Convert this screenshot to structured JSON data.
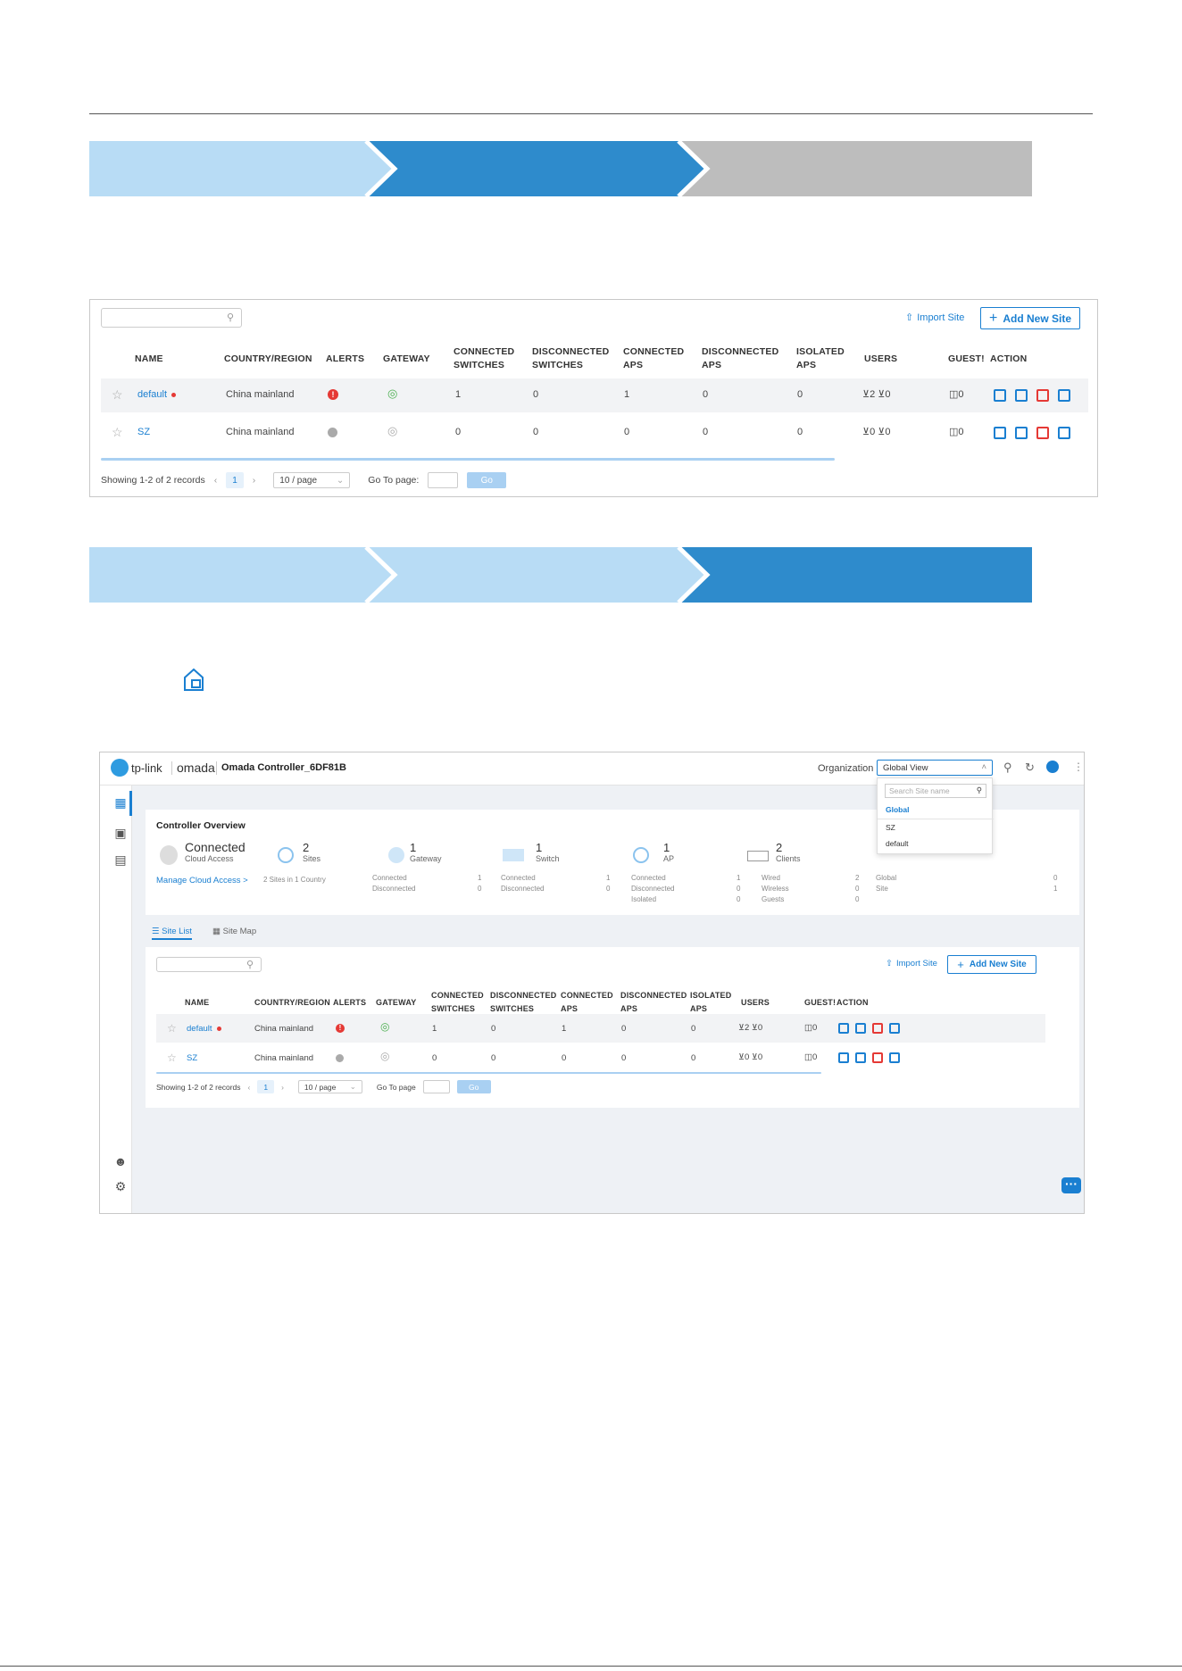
{
  "steps_top": {
    "colors": [
      "#b8dcf5",
      "#2e8bcc",
      "#bdbdbd"
    ]
  },
  "steps_mid": {
    "colors": [
      "#b8dcf5",
      "#b8dcf5",
      "#2e8bcc"
    ]
  },
  "colors": {
    "accent": "#1a7fd1",
    "alert_red": "#e53935",
    "gateway_green": "#4caf50"
  },
  "table": {
    "import_label": "Import Site",
    "add_label": "Add New Site",
    "headers": {
      "name": "NAME",
      "country": "COUNTRY/REGION",
      "alerts": "ALERTS",
      "gateway": "GATEWAY",
      "conn_sw_1": "CONNECTED",
      "conn_sw_2": "SWITCHES",
      "disc_sw_1": "DISCONNECTED",
      "disc_sw_2": "SWITCHES",
      "conn_ap_1": "CONNECTED",
      "conn_ap_2": "APS",
      "disc_ap_1": "DISCONNECTED",
      "disc_ap_2": "APS",
      "iso_1": "ISOLATED",
      "iso_2": "APS",
      "users": "USERS",
      "guests": "GUEST!",
      "action": "ACTION"
    },
    "rows": [
      {
        "name": "default",
        "country": "China mainland",
        "conn_sw": "1",
        "disc_sw": "0",
        "conn_ap": "1",
        "disc_ap": "0",
        "iso": "0",
        "users_a": "2",
        "users_b": "0",
        "guests": "0"
      },
      {
        "name": "SZ",
        "country": "China mainland",
        "conn_sw": "0",
        "disc_sw": "0",
        "conn_ap": "0",
        "disc_ap": "0",
        "iso": "0",
        "users_a": "0",
        "users_b": "0",
        "guests": "0"
      }
    ],
    "showing": "Showing 1-2 of 2 records",
    "page": "1",
    "per_page": "10 / page",
    "goto_label": "Go To page:",
    "go_label": "Go"
  },
  "app": {
    "brand": "tp-link",
    "product": "omada",
    "title": "Omada Controller_6DF81B",
    "org_label": "Organization",
    "org_value": "Global View",
    "dropdown": {
      "search_placeholder": "Search Site name",
      "items": [
        "Global",
        "SZ",
        "default"
      ]
    },
    "overview_title": "Controller Overview",
    "cloud_status": "Connected",
    "cloud_sub": "Cloud Access",
    "manage_link": "Manage Cloud Access >",
    "stats": [
      {
        "num": "2",
        "label": "Sites",
        "sub": "2 Sites in 1 Country"
      },
      {
        "num": "1",
        "label": "Gateway",
        "rows": [
          [
            "Connected",
            "1"
          ],
          [
            "Disconnected",
            "0"
          ]
        ]
      },
      {
        "num": "1",
        "label": "Switch",
        "rows": [
          [
            "Connected",
            "1"
          ],
          [
            "Disconnected",
            "0"
          ]
        ]
      },
      {
        "num": "1",
        "label": "AP",
        "rows": [
          [
            "Connected",
            "1"
          ],
          [
            "Disconnected",
            "0"
          ],
          [
            "Isolated",
            "0"
          ]
        ]
      },
      {
        "num": "2",
        "label": "Clients",
        "rows": [
          [
            "Wired",
            "2"
          ],
          [
            "Wireless",
            "0"
          ],
          [
            "Guests",
            "0"
          ]
        ]
      },
      {
        "rows": [
          [
            "Global",
            "0"
          ],
          [
            "Site",
            "1"
          ]
        ]
      }
    ],
    "tab_site_list": "Site List",
    "tab_site_map": "Site Map",
    "showing": "Showing 1-2 of 2 records",
    "goto_label": "Go To page"
  }
}
